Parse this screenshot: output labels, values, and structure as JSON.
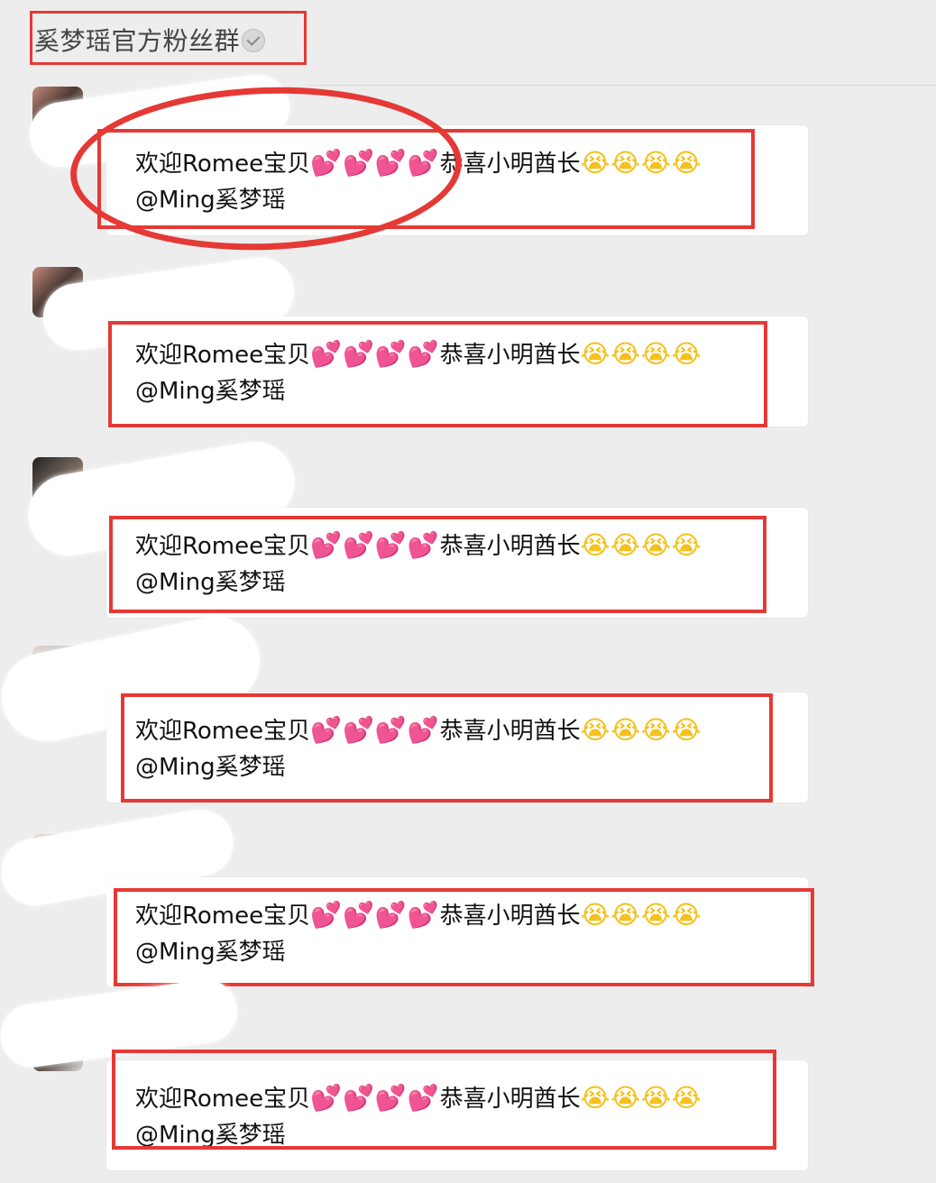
{
  "group": {
    "title": "奚梦瑶官方粉丝群"
  },
  "messages": [
    {
      "text_1": "欢迎Romee宝贝",
      "hearts": "💕💕💕💕",
      "text_2": "恭喜小明酋长",
      "cry": "😭😭😭😭",
      "line_2": "@Ming奚梦瑶"
    },
    {
      "text_1": "欢迎Romee宝贝",
      "hearts": "💕💕💕💕",
      "text_2": "恭喜小明酋长",
      "cry": "😭😭😭😭",
      "line_2": "@Ming奚梦瑶"
    },
    {
      "text_1": "欢迎Romee宝贝",
      "hearts": "💕💕💕💕",
      "text_2": "恭喜小明酋长",
      "cry": "😭😭😭😭",
      "line_2": "@Ming奚梦瑶"
    },
    {
      "text_1": "欢迎Romee宝贝",
      "hearts": "💕💕💕💕",
      "text_2": "恭喜小明酋长",
      "cry": "😭😭😭😭",
      "line_2": "@Ming奚梦瑶"
    },
    {
      "text_1": "欢迎Romee宝贝",
      "hearts": "💕💕💕💕",
      "text_2": "恭喜小明酋长",
      "cry": "😭😭😭😭",
      "line_2": "@Ming奚梦瑶"
    },
    {
      "text_1": "欢迎Romee宝贝",
      "hearts": "💕💕💕💕",
      "text_2": "恭喜小明酋长",
      "cry": "😭😭😭😭",
      "line_2": "@Ming奚梦瑶"
    }
  ]
}
